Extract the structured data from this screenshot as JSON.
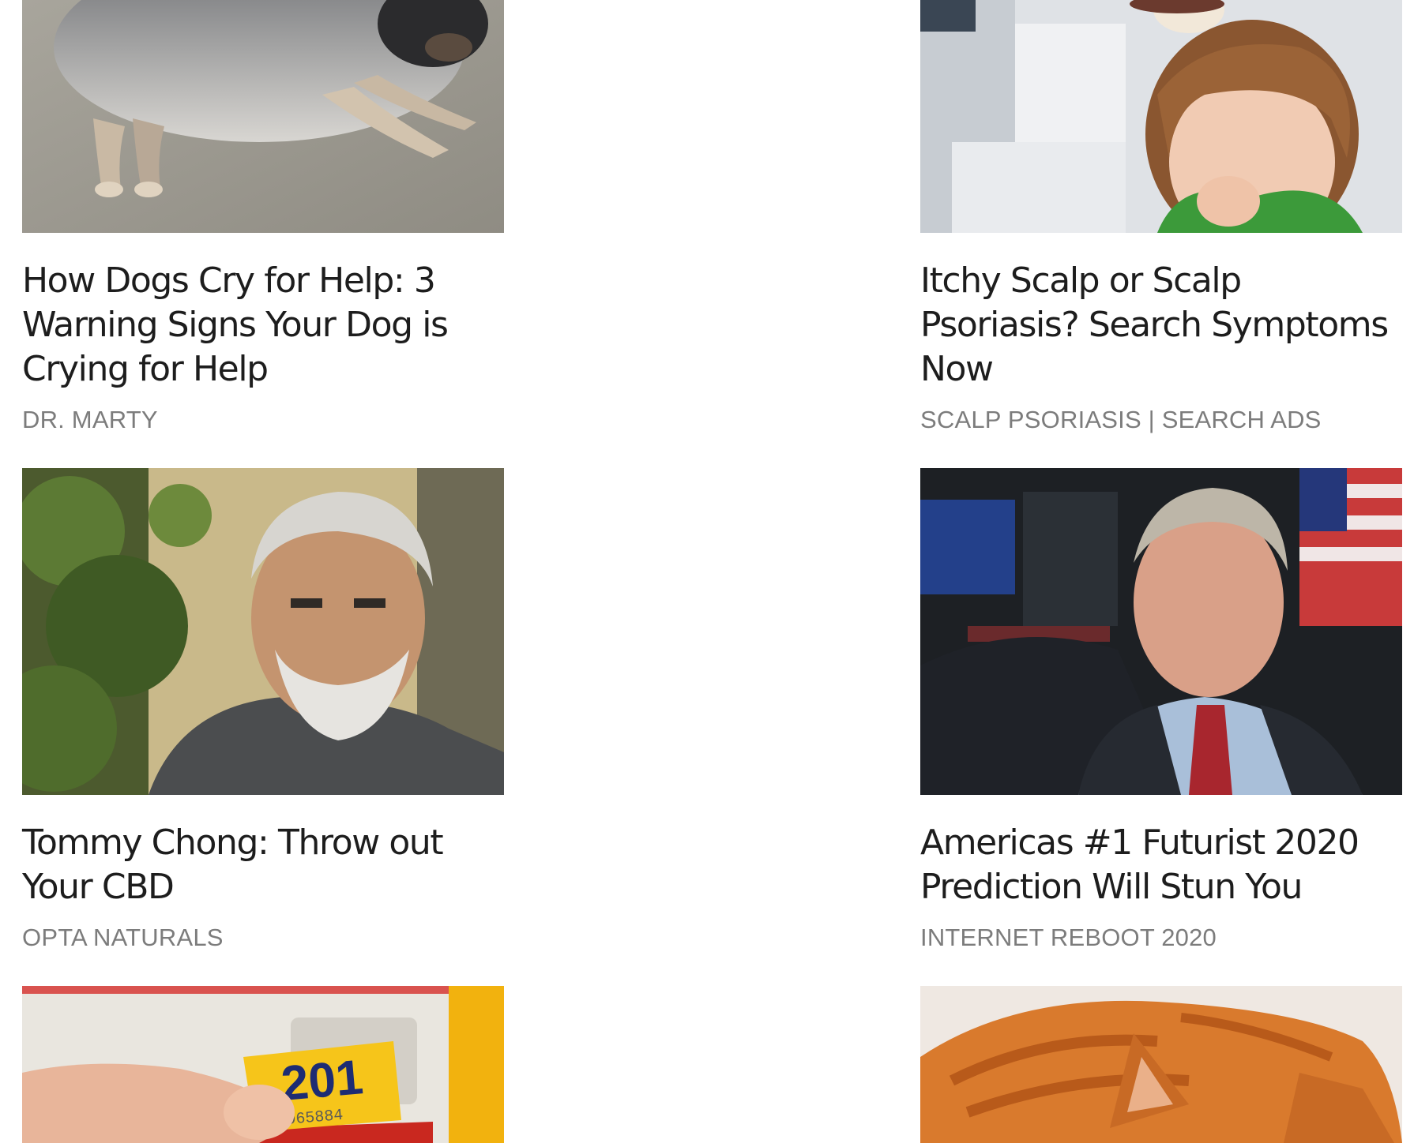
{
  "cards": [
    {
      "headline": "How Dogs Cry for Help: 3 Warning Signs Your Dog is Crying for Help",
      "source": "DR. MARTY",
      "image": "dog-lying-on-concrete"
    },
    {
      "headline": "Itchy Scalp or Scalp Psoriasis? Search Symptoms Now",
      "source": "SCALP PSORIASIS | SEARCH ADS",
      "image": "child-with-hair-brush"
    },
    {
      "headline": "Tommy Chong: Throw out Your CBD",
      "source": "OPTA NATURALS",
      "image": "gray-haired-man-outdoors"
    },
    {
      "headline": "Americas #1 Futurist 2020 Prediction Will Stun You",
      "source": "INTERNET REBOOT 2020",
      "image": "man-in-suit-red-tie"
    },
    {
      "headline": "",
      "source": "",
      "image": "hand-peeling-license-plate-sticker",
      "sticker_year": "201",
      "sticker_number": "965884"
    },
    {
      "headline": "",
      "source": "",
      "image": "orange-tabby-cat"
    }
  ],
  "colors": {
    "headline": "#1d1d1d",
    "source": "#7c7c7c",
    "background": "#ffffff"
  }
}
